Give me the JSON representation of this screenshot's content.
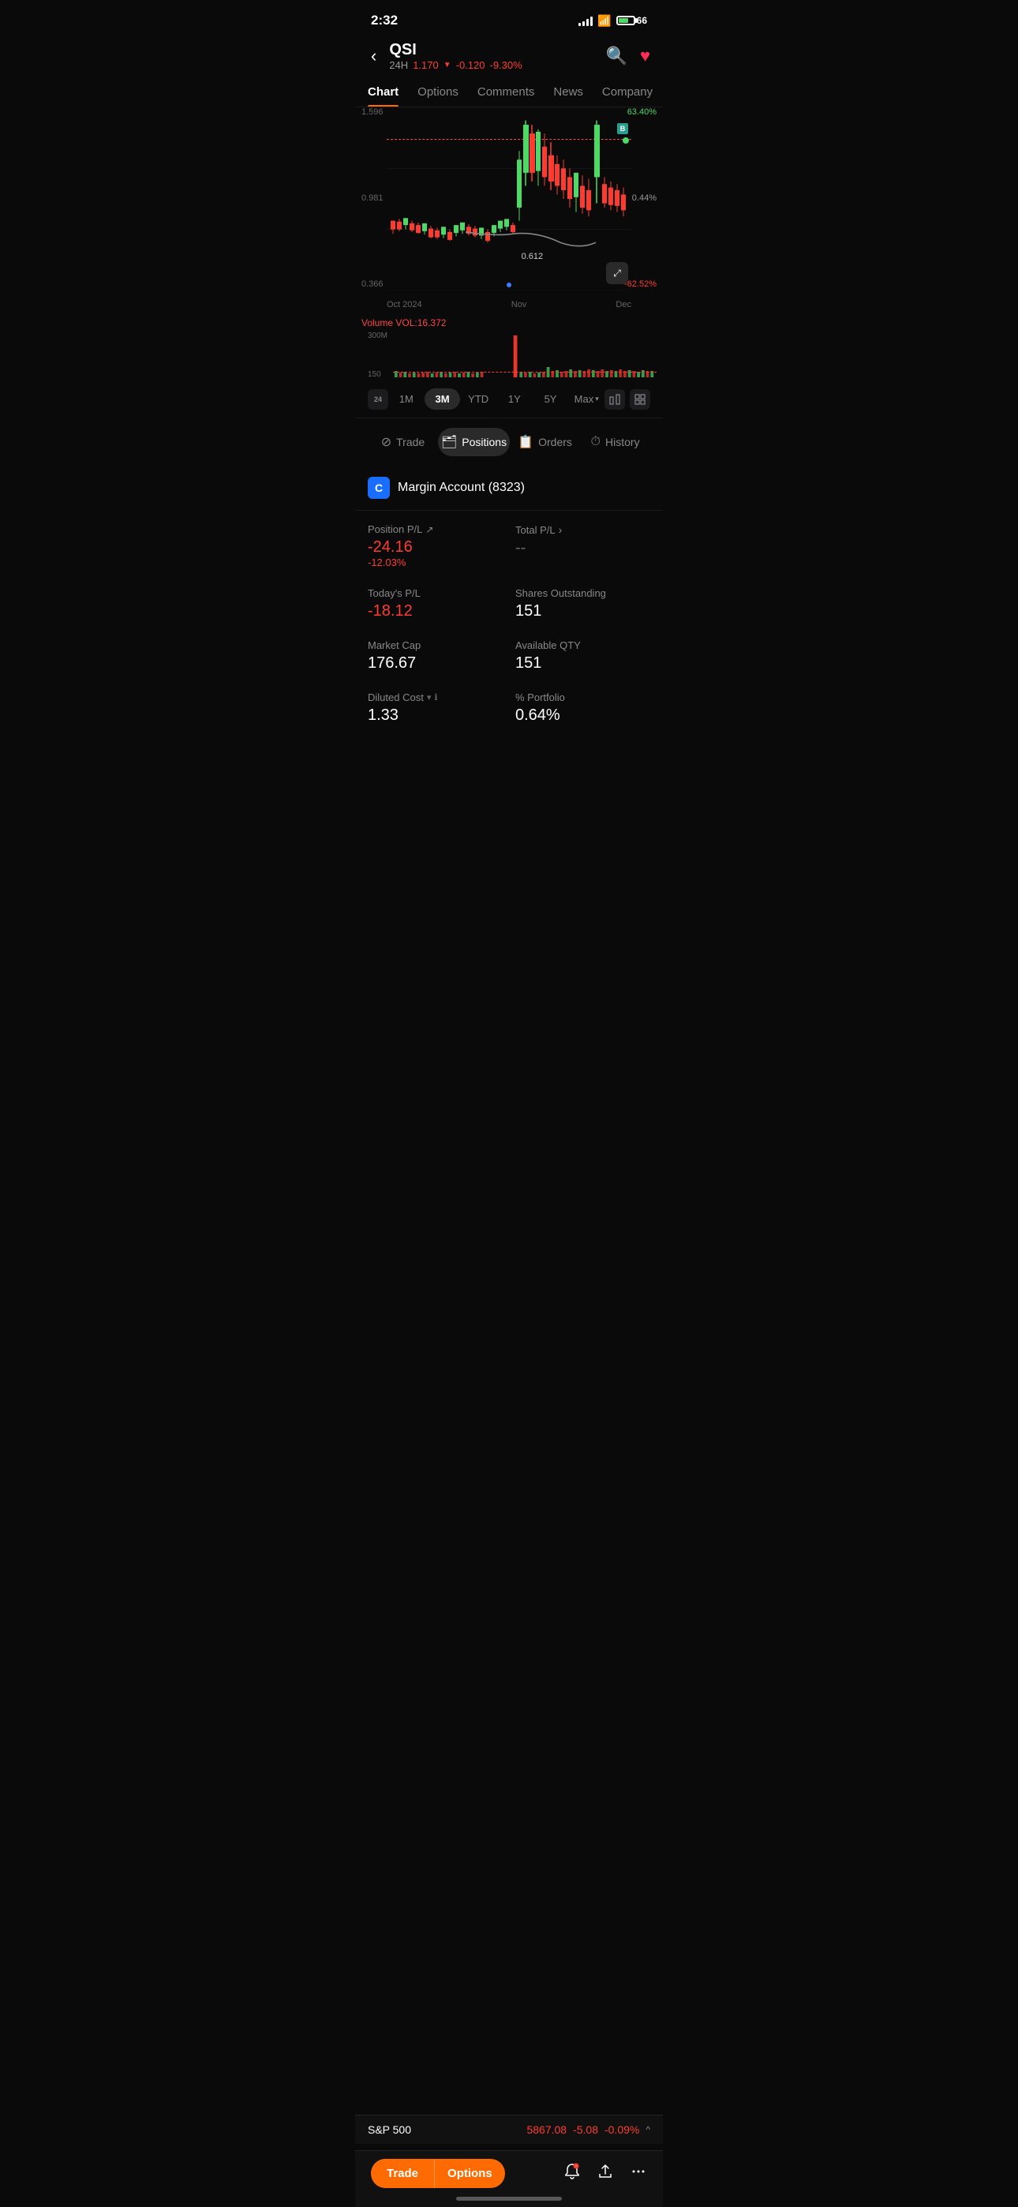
{
  "statusBar": {
    "time": "2:32",
    "battery": "66"
  },
  "header": {
    "ticker": "QSI",
    "period": "24H",
    "price": "1.170",
    "downArrow": "▼",
    "change": "-0.120",
    "changePct": "-9.30%"
  },
  "tabs": {
    "items": [
      {
        "label": "Chart",
        "active": true
      },
      {
        "label": "Options",
        "active": false
      },
      {
        "label": "Comments",
        "active": false
      },
      {
        "label": "News",
        "active": false
      },
      {
        "label": "Company",
        "active": false
      }
    ]
  },
  "chart": {
    "yLabels": {
      "top": "1.596",
      "mid": "0.981",
      "bot": "0.366"
    },
    "yLabelsRight": {
      "top": "63.40%",
      "mid": "0.44%",
      "bot": "-62.52%"
    },
    "xLabels": [
      "Oct 2024",
      "Nov",
      "Dec"
    ],
    "priceLabel": "0.612",
    "badgeB": "B"
  },
  "volume": {
    "label": "Volume",
    "vol": "VOL:16.372",
    "yLabels": [
      "300M",
      "150"
    ]
  },
  "timeRange": {
    "buttons": [
      "24",
      "1M",
      "3M",
      "YTD",
      "1Y",
      "5Y",
      "Max ▾"
    ]
  },
  "bottomTabs": [
    {
      "label": "Trade",
      "icon": "⊘",
      "active": false
    },
    {
      "label": "Positions",
      "icon": "🗂",
      "active": true
    },
    {
      "label": "Orders",
      "icon": "📋",
      "active": false
    },
    {
      "label": "History",
      "icon": "⏱",
      "active": false
    }
  ],
  "account": {
    "icon": "C",
    "name": "Margin Account (8323)"
  },
  "positions": {
    "positionPL": {
      "label": "Position P/L",
      "value": "-24.16",
      "subvalue": "-12.03%"
    },
    "totalPL": {
      "label": "Total P/L",
      "value": "--"
    },
    "todaysPL": {
      "label": "Today's P/L",
      "value": "-18.12"
    },
    "sharesOutstanding": {
      "label": "Shares Outstanding",
      "value": "151"
    },
    "marketCap": {
      "label": "Market Cap",
      "value": "176.67"
    },
    "availableQty": {
      "label": "Available QTY",
      "value": "151"
    },
    "dilutedCost": {
      "label": "Diluted Cost",
      "value": "1.33"
    },
    "portfolioPct": {
      "label": "% Portfolio",
      "value": "0.64%"
    }
  },
  "sp500": {
    "label": "S&P 500",
    "price": "5867.08",
    "change": "-5.08",
    "changePct": "-0.09%"
  },
  "bottomBar": {
    "tradeLabel": "Trade",
    "optionsLabel": "Options"
  }
}
